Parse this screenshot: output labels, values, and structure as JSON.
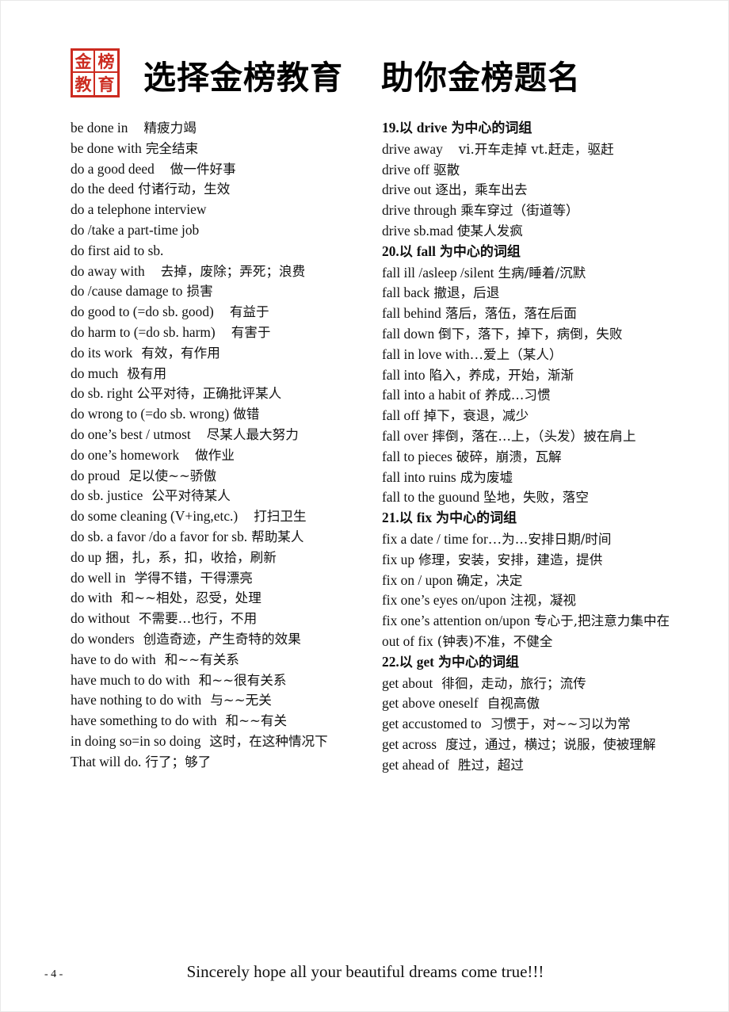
{
  "header": {
    "seal": {
      "chars": [
        "金",
        "榜",
        "教",
        "育"
      ],
      "color": "#cc2b20",
      "name": "jinbang-jiaoyu-seal"
    },
    "title_main": "选择金榜教育",
    "title_sub": "助你金榜题名"
  },
  "left_column": [
    {
      "en": "be done in",
      "sp": "sp3",
      "zh": "精疲力竭"
    },
    {
      "en": "be done with",
      "sp": "sp1",
      "zh": "完全结束"
    },
    {
      "en": "do a good deed",
      "sp": "sp3",
      "zh": "做一件好事"
    },
    {
      "en": "do the deed",
      "sp": "sp1",
      "zh": "付诸行动，生效"
    },
    {
      "en": "do a telephone interview",
      "sp": "sp1",
      "zh": ""
    },
    {
      "en": "do /take a part-time job",
      "sp": "sp1",
      "zh": ""
    },
    {
      "en": "do first aid to sb.",
      "sp": "sp1",
      "zh": ""
    },
    {
      "en": "do away with",
      "sp": "sp3",
      "zh": "去掉，废除；弄死；浪费"
    },
    {
      "en": "do /cause damage to",
      "sp": "sp1",
      "zh": "损害"
    },
    {
      "en": "do good to (=do sb. good)",
      "sp": "sp3",
      "zh": "有益于"
    },
    {
      "en": "do harm to (=do sb. harm)",
      "sp": "sp3",
      "zh": "有害于"
    },
    {
      "en": "do its work",
      "sp": "sp2",
      "zh": "有效，有作用"
    },
    {
      "en": "do much",
      "sp": "sp2",
      "zh": "极有用"
    },
    {
      "en": "do sb. right",
      "sp": "sp1",
      "zh": "公平对待，正确批评某人"
    },
    {
      "en": "do wrong to (=do sb. wrong)",
      "sp": "sp1",
      "zh": "做错"
    },
    {
      "en": "do one’s best / utmost",
      "sp": "sp3",
      "zh": "尽某人最大努力"
    },
    {
      "en": "do one’s homework",
      "sp": "sp3",
      "zh": "做作业"
    },
    {
      "en": "do proud",
      "sp": "sp2",
      "zh": "足以使~~骄傲"
    },
    {
      "en": "do sb. justice",
      "sp": "sp2",
      "zh": "公平对待某人"
    },
    {
      "en": "do some cleaning (V+ing,etc.)",
      "sp": "sp3",
      "zh": "打扫卫生"
    },
    {
      "en": "do sb. a favor /do a favor for sb.",
      "sp": "sp1",
      "zh": "帮助某人"
    },
    {
      "en": "do up",
      "sp": "sp1",
      "zh": "捆，扎，系，扣，收拾，刷新"
    },
    {
      "en": "do well in",
      "sp": "sp2",
      "zh": "学得不错，干得漂亮"
    },
    {
      "en": "do with",
      "sp": "sp2",
      "zh": "和~~相处，忍受，处理"
    },
    {
      "en": "do without",
      "sp": "sp2",
      "zh": "不需要…也行，不用"
    },
    {
      "en": "do wonders",
      "sp": "sp2",
      "zh": "创造奇迹，产生奇特的效果"
    },
    {
      "en": "have to do with",
      "sp": "sp2",
      "zh": "和~~有关系"
    },
    {
      "en": "have much to do with",
      "sp": "sp2",
      "zh": "和~~很有关系"
    },
    {
      "en": "have nothing to do with",
      "sp": "sp2",
      "zh": "与~~无关"
    },
    {
      "en": "have something to do with",
      "sp": "sp2",
      "zh": "和~~有关"
    },
    {
      "en": "in doing so=in so doing",
      "sp": "sp2",
      "zh": "这时，在这种情况下"
    },
    {
      "en": "That will do.",
      "sp": "sp1",
      "zh": "行了；够了"
    }
  ],
  "right_column": [
    {
      "heading": true,
      "num": "19.",
      "zh_pre": "以",
      "en": "drive",
      "zh_post": "为中心的词组"
    },
    {
      "en": "drive away",
      "sp": "sp3",
      "zh": "vi.开车走掉  vt.赶走，驱赶"
    },
    {
      "en": "drive off",
      "sp": "sp1",
      "zh": "驱散"
    },
    {
      "en": "drive out",
      "sp": "sp1",
      "zh": "逐出，乘车出去"
    },
    {
      "en": "drive through",
      "sp": "sp1",
      "zh": "乘车穿过（街道等）"
    },
    {
      "en": "drive sb.mad",
      "sp": "sp1",
      "zh": "使某人发疯"
    },
    {
      "heading": true,
      "num": "20.",
      "zh_pre": "以",
      "en": "fall",
      "zh_post": "为中心的词组"
    },
    {
      "en": "fall ill /asleep /silent",
      "sp": "sp1",
      "zh": "生病/睡着/沉默"
    },
    {
      "en": "fall back",
      "sp": "sp1",
      "zh": "撤退，后退"
    },
    {
      "en": "fall behind",
      "sp": "sp1",
      "zh": "落后，落伍，落在后面"
    },
    {
      "en": "fall down",
      "sp": "sp1",
      "zh": "倒下，落下，掉下，病倒，失败"
    },
    {
      "en": "fall in love with…",
      "sp": "",
      "zh": "爱上（某人）"
    },
    {
      "en": "fall into",
      "sp": "sp1",
      "zh": "陷入，养成，开始，渐渐"
    },
    {
      "en": "fall into a habit of",
      "sp": "sp1",
      "zh": "养成…习惯"
    },
    {
      "en": "fall off",
      "sp": "sp1",
      "zh": "掉下，衰退，减少"
    },
    {
      "en": "fall over",
      "sp": "sp1",
      "zh": "摔倒，落在…上，（头发）披在肩上"
    },
    {
      "en": "fall to pieces",
      "sp": "sp1",
      "zh": "破碎，崩溃，瓦解"
    },
    {
      "en": "fall into ruins",
      "sp": "sp1",
      "zh": "成为废墟"
    },
    {
      "en": "fall to the guound",
      "sp": "sp1",
      "zh": "坠地，失败，落空"
    },
    {
      "heading": true,
      "num": "21.",
      "zh_pre": "以",
      "en": "fix",
      "zh_post": "为中心的词组"
    },
    {
      "en": "fix a date / time for…",
      "sp": "",
      "zh": "为…安排日期/时间"
    },
    {
      "en": "fix up",
      "sp": "sp1",
      "zh": "修理，安装，安排，建造，提供"
    },
    {
      "en": "fix on / upon",
      "sp": "sp1",
      "zh": "确定，决定"
    },
    {
      "en": "fix one’s eyes on/upon",
      "sp": "sp1",
      "zh": "注视，凝视"
    },
    {
      "en": "fix one’s attention on/upon",
      "sp": "sp1",
      "zh": "专心于,把注意力集中在"
    },
    {
      "en": "out of fix",
      "sp": "sp1",
      "zh": "(钟表)不准，不健全"
    },
    {
      "heading": true,
      "num": "22.",
      "zh_pre": "以",
      "en": "get",
      "zh_post": "为中心的词组"
    },
    {
      "en": "get about",
      "sp": "sp2",
      "zh": "徘徊，走动，旅行；流传"
    },
    {
      "en": "get above oneself",
      "sp": "sp2",
      "zh": "自视高傲"
    },
    {
      "en": "get accustomed to",
      "sp": "sp2",
      "zh": "习惯于，对~~习以为常"
    },
    {
      "en": "get across",
      "sp": "sp2",
      "zh": "度过，通过，横过；说服，使被理解"
    },
    {
      "en": "get ahead of",
      "sp": "sp2",
      "zh": "胜过，超过"
    }
  ],
  "footer": {
    "page_number": "- 4 -",
    "motto": "Sincerely hope all your beautiful dreams come true!!!"
  }
}
